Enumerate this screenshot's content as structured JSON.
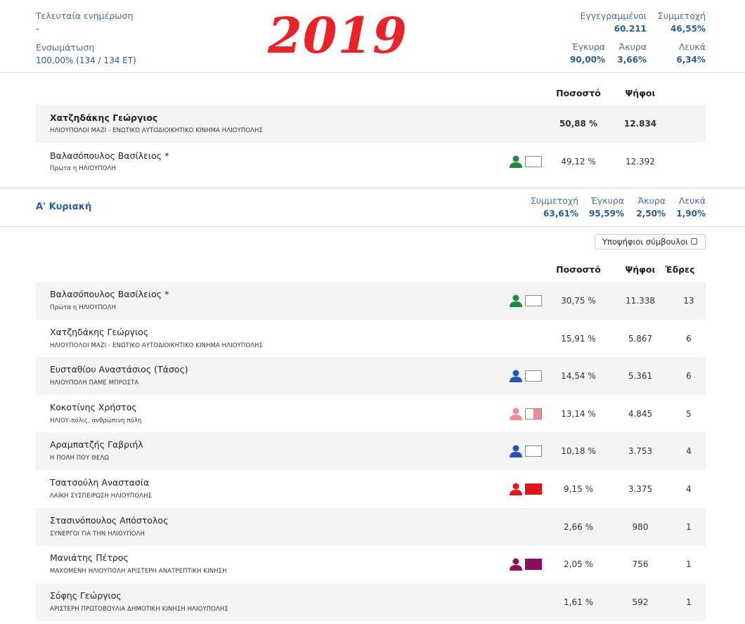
{
  "header": {
    "last_update_label": "Τελευταία ενημέρωση",
    "last_update_value": "-",
    "integration_label": "Ενσωμάτωση",
    "integration_value": "100,00% (134 / 134 ΕΤ)",
    "year": "2019",
    "registered_label": "Εγγεγραμμένοι",
    "registered_value": "60.211",
    "participation_label": "Συμμετοχή",
    "participation_value": "46,55%",
    "valid_label": "Έγκυρα",
    "valid_value": "90,00%",
    "invalid_label": "Άκυρα",
    "invalid_value": "3,66%",
    "blank_label": "Λευκά",
    "blank_value": "6,34%"
  },
  "top_table": {
    "col_percent": "Ποσοστό",
    "col_votes": "Ψήφοι",
    "rows": [
      {
        "name": "Χατζηδάκης Γεώργιος",
        "party": "ΗΛΙΟΥΠΟΛΟΙ ΜΑΖΙ - ΕΝΩΤΙΚΟ ΑΥΤΟΔΙΟΙΚΗΤΙΚΟ ΚΙΝΗΜΑ ΗΛΙΟΥΠΟΛΗΣ",
        "percent": "50,88 %",
        "votes": "12.834",
        "icon": "none"
      },
      {
        "name": "Βαλασόπουλος Βασίλειος *",
        "party": "Πρώτα η ΗΛΙΟΥΠΟΛΗ",
        "percent": "49,12 %",
        "votes": "12.392",
        "icon": "person-icon",
        "person_color": "#1e8a3a",
        "swatch_color": "#ffffff"
      }
    ]
  },
  "round": {
    "title": "Α' Κυριακή",
    "participation_label": "Συμμετοχή",
    "participation_value": "63,61%",
    "valid_label": "Έγκυρα",
    "valid_value": "95,59%",
    "invalid_label": "Άκυρα",
    "invalid_value": "2,50%",
    "blank_label": "Λευκά",
    "blank_value": "1,90%",
    "candidates_toggle": "Υποψήφιοι σύμβουλοι"
  },
  "main_table": {
    "col_percent": "Ποσοστό",
    "col_votes": "Ψήφοι",
    "col_seats": "Έδρες",
    "rows": [
      {
        "name": "Βαλασόπουλος Βασίλειος *",
        "party": "Πρώτα η ΗΛΙΟΥΠΟΛΗ",
        "percent": "30,75 %",
        "votes": "11.338",
        "seats": "13",
        "person_color": "#1e8a3a",
        "swatch_color": "#ffffff",
        "swatch_half": ""
      },
      {
        "name": "Χατζηδάκης Γεώργιος",
        "party": "ΗΛΙΟΥΠΟΛΟΙ ΜΑΖΙ - ΕΝΩΤΙΚΟ ΑΥΤΟΔΙΟΙΚΗΤΙΚΟ ΚΙΝΗΜΑ ΗΛΙΟΥΠΟΛΗΣ",
        "percent": "15,91 %",
        "votes": "5.867",
        "seats": "6",
        "person_color": "",
        "swatch_color": "",
        "swatch_half": ""
      },
      {
        "name": "Ευσταθίου Αναστάσιος (Τάσος)",
        "party": "ΗΛΙΟΥΠΟΛΗ ΠΑΜΕ ΜΠΡΟΣΤΑ",
        "percent": "14,54 %",
        "votes": "5.361",
        "seats": "6",
        "person_color": "#1f56b8",
        "swatch_color": "#ffffff",
        "swatch_half": ""
      },
      {
        "name": "Κοκοτίνης Χρήστος",
        "party": "ΗΛΙΟΥ-πόλις, ανθρώπινη πόλη",
        "percent": "13,14 %",
        "votes": "4.845",
        "seats": "5",
        "person_color": "#f08a94",
        "swatch_color": "#ffffff",
        "swatch_half": "#f08a94"
      },
      {
        "name": "Αραμπατζής Γαβριήλ",
        "party": "Η ΠΟΛΗ ΠΟΥ ΘΕΛΩ",
        "percent": "10,18 %",
        "votes": "3.753",
        "seats": "4",
        "person_color": "#1f56b8",
        "swatch_color": "#ffffff",
        "swatch_half": ""
      },
      {
        "name": "Τσατσούλη Αναστασία",
        "party": "ΛΑΪΚΗ ΣΥΣΠΕΙΡΩΣΗ ΗΛΙΟΥΠΟΛΗΣ",
        "percent": "9,15 %",
        "votes": "3.375",
        "seats": "4",
        "person_color": "#e0161b",
        "swatch_color": "#e0161b",
        "swatch_half": ""
      },
      {
        "name": "Στασινόπουλος Απόστολος",
        "party": "ΣΥΝΕΡΓΟΙ ΓΙΑ ΤΗΝ ΗΛΙΟΥΠΟΛΗ",
        "percent": "2,66 %",
        "votes": "980",
        "seats": "1",
        "person_color": "",
        "swatch_color": "",
        "swatch_half": ""
      },
      {
        "name": "Μανιάτης Πέτρος",
        "party": "ΜΑΧΟΜΕΝΗ ΗΛΙΟΥΠΟΛΗ ΑΡΙΣΤΕΡΗ ΑΝΑΤΡΕΠΤΙΚΗ ΚΙΝΗΣΗ",
        "percent": "2,05 %",
        "votes": "756",
        "seats": "1",
        "person_color": "#8a0f5c",
        "swatch_color": "#8a0f5c",
        "swatch_half": ""
      },
      {
        "name": "Σόφης Γεώργιος",
        "party": "ΑΡΙΣΤΕΡΗ ΠΡΩΤΟΒΟΥΛΙΑ ΔΗΜΟΤΙΚΗ ΚΙΝΗΣΗ ΗΛΙΟΥΠΟΛΗΣ",
        "percent": "1,61 %",
        "votes": "592",
        "seats": "1",
        "person_color": "",
        "swatch_color": "",
        "swatch_half": ""
      }
    ]
  }
}
